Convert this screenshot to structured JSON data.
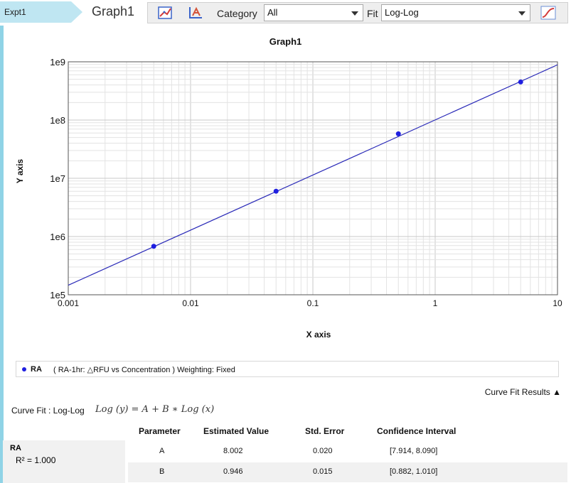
{
  "tabs": {
    "experiment": "Expt1",
    "graph": "Graph1"
  },
  "toolbar": {
    "category_label": "Category",
    "category_value": "All",
    "fit_label": "Fit",
    "fit_value": "Log-Log"
  },
  "chart_data": {
    "type": "scatter",
    "title": "Graph1",
    "xlabel": "X axis",
    "ylabel": "Y axis",
    "xscale": "log",
    "yscale": "log",
    "xlim": [
      0.001,
      10
    ],
    "ylim": [
      100000,
      1000000000
    ],
    "x_ticks": [
      "0.001",
      "0.01",
      "0.1",
      "1",
      "10"
    ],
    "y_ticks": [
      "1e5",
      "1e6",
      "1e7",
      "1e8",
      "1e9"
    ],
    "grid": true,
    "series": [
      {
        "name": "RA",
        "color": "#1f1fe0",
        "x": [
          0.005,
          0.05,
          0.5,
          5
        ],
        "y": [
          680000,
          6000000,
          58000000,
          450000000
        ],
        "fit": {
          "A": 8.002,
          "B": 0.946
        }
      }
    ]
  },
  "legend": {
    "name": "RA",
    "description": "( RA-1hr: △RFU vs Concentration )  Weighting: Fixed"
  },
  "curve_fit": {
    "results_label": "Curve Fit Results ▲",
    "title": "Curve Fit : Log-Log",
    "equation": "Log (y) = A + B ∗ Log (x)",
    "headers": [
      "Parameter",
      "Estimated Value",
      "Std. Error",
      "Confidence Interval"
    ],
    "series_name": "RA",
    "r_squared": "R² = 1.000",
    "rows": [
      {
        "parameter": "A",
        "estimate": "8.002",
        "std_error": "0.020",
        "ci": "[7.914, 8.090]"
      },
      {
        "parameter": "B",
        "estimate": "0.946",
        "std_error": "0.015",
        "ci": "[0.882, 1.010]"
      }
    ]
  }
}
